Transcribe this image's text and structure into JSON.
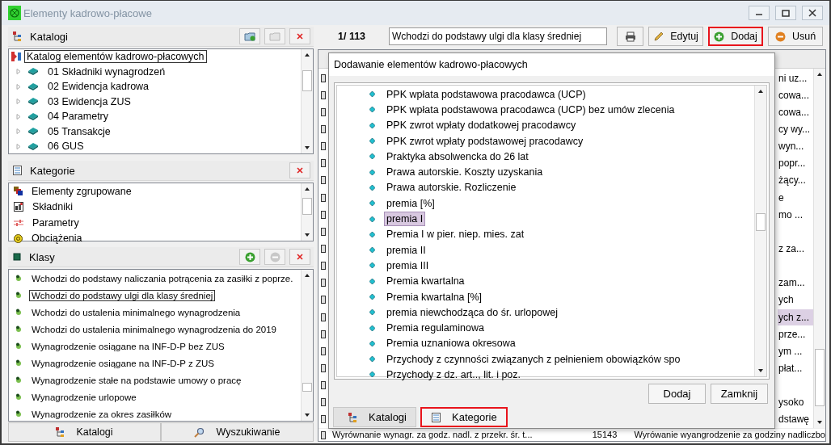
{
  "window": {
    "title": "Elementy kadrowo-płacowe"
  },
  "catalogs_panel": {
    "title": "Katalogi",
    "root": {
      "label": "Katalog elementów kadrowo-płacowych",
      "selected": true
    },
    "items": [
      {
        "label": "01 Składniki wynagrodzeń",
        "expanded": false
      },
      {
        "label": "02 Ewidencja kadrowa",
        "expanded": false
      },
      {
        "label": "03 Ewidencja ZUS",
        "expanded": false
      },
      {
        "label": "04 Parametry",
        "expanded": false
      },
      {
        "label": "05 Transakcje",
        "expanded": false
      },
      {
        "label": "06 GUS",
        "expanded": false
      }
    ]
  },
  "categories_panel": {
    "title": "Kategorie",
    "items": [
      {
        "label": "Elementy zgrupowane",
        "kind": "group"
      },
      {
        "label": "Składniki",
        "kind": "component"
      },
      {
        "label": "Parametry",
        "kind": "parameter"
      },
      {
        "label": "Obciążenia",
        "kind": "charge"
      }
    ]
  },
  "classes_panel": {
    "title": "Klasy",
    "items": [
      {
        "label": "Wchodzi do podstawy naliczania potrącenia za zasiłki z poprze.",
        "selected": false
      },
      {
        "label": "Wchodzi do podstawy ulgi dla klasy średniej",
        "selected": true
      },
      {
        "label": "Wchodzi do ustalenia minimalnego wynagrodzenia",
        "selected": false
      },
      {
        "label": "Wchodzi do ustalenia minimalnego wynagrodzenia do 2019",
        "selected": false
      },
      {
        "label": "Wynagrodzenie osiągane na INF-D-P bez ZUS",
        "selected": false
      },
      {
        "label": "Wynagrodzenie osiągane na INF-D-P z ZUS",
        "selected": false
      },
      {
        "label": "Wynagrodzenie stałe na podstawie umowy o pracę",
        "selected": false
      },
      {
        "label": "Wynagrodzenie urlopowe",
        "selected": false
      },
      {
        "label": "Wynagrodzenie za okres zasiłków",
        "selected": false
      }
    ]
  },
  "left_tabs": [
    {
      "label": "Katalogi",
      "kind": "catalogs"
    },
    {
      "label": "Wyszukiwanie",
      "kind": "search"
    }
  ],
  "toolbar": {
    "counter": "1/ 113",
    "field_value": "Wchodzi do podstawy ulgi dla klasy średniej",
    "buttons": [
      {
        "label": "Edytuj",
        "kind": "edit",
        "highlighted": false
      },
      {
        "label": "Dodaj",
        "kind": "add",
        "highlighted": true
      },
      {
        "label": "Usuń",
        "kind": "remove",
        "highlighted": false
      }
    ]
  },
  "grid": {
    "rows": [
      {
        "text": "ni uz...",
        "selected": false
      },
      {
        "text": "cowa...",
        "selected": false
      },
      {
        "text": "cowa...",
        "selected": false
      },
      {
        "text": "cy wy...",
        "selected": false
      },
      {
        "text": "wyn...",
        "selected": false
      },
      {
        "text": "popr...",
        "selected": false
      },
      {
        "text": "żący...",
        "selected": false
      },
      {
        "text": "e",
        "selected": false
      },
      {
        "text": "mo ...",
        "selected": false
      },
      {
        "selected": false
      },
      {
        "text": "z za...",
        "selected": false
      },
      {
        "selected": false
      },
      {
        "text": "zam...",
        "selected": false
      },
      {
        "text": "ych",
        "selected": false
      },
      {
        "text": "ych z...",
        "selected": true
      },
      {
        "text": "prze...",
        "selected": false
      },
      {
        "text": "ym ...",
        "selected": false
      },
      {
        "text": "płat...",
        "selected": false
      },
      {
        "selected": false
      },
      {
        "text": "ysoko",
        "selected": false
      },
      {
        "text": "dstawę",
        "selected": false
      }
    ],
    "bottom_row": [
      "Wyrównanie wynagr. za godz. nadl. z przekr. śr. t...",
      "15143",
      "Wyrówanie wyangrodzenie za godziny nadliczbo"
    ]
  },
  "dialog": {
    "title": "Dodawanie elementów kadrowo-płacowych",
    "items": [
      {
        "label": "PPK wpłata podstawowa pracodawca (UCP)",
        "selected": false
      },
      {
        "label": "PPK wpłata podstawowa pracodawca (UCP) bez umów zlecenia",
        "selected": false
      },
      {
        "label": "PPK zwrot wpłaty dodatkowej pracodawcy",
        "selected": false
      },
      {
        "label": "PPK zwrot wpłaty podstawowej pracodawcy",
        "selected": false
      },
      {
        "label": "Praktyka absolwencka do 26 lat",
        "selected": false
      },
      {
        "label": "Prawa autorskie. Koszty uzyskania",
        "selected": false
      },
      {
        "label": "Prawa autorskie. Rozliczenie",
        "selected": false
      },
      {
        "label": "premia [%]",
        "selected": false
      },
      {
        "label": "premia I",
        "selected": true
      },
      {
        "label": "Premia I w pier. niep. mies. zat",
        "selected": false
      },
      {
        "label": "premia II",
        "selected": false
      },
      {
        "label": "premia III",
        "selected": false
      },
      {
        "label": "Premia kwartalna",
        "selected": false
      },
      {
        "label": "Premia kwartalna [%]",
        "selected": false
      },
      {
        "label": "premia niewchodząca do śr. urlopowej",
        "selected": false
      },
      {
        "label": "Premia regulaminowa",
        "selected": false
      },
      {
        "label": "Premia uznaniowa okresowa",
        "selected": false
      },
      {
        "label": "Przychody z czynności związanych z pełnieniem obowiązków spo",
        "selected": false
      },
      {
        "label": "Przychody z dz. art.., lit. i poz.",
        "selected": false
      }
    ],
    "buttons": [
      "Dodaj",
      "Zamknij"
    ],
    "tabs": [
      {
        "label": "Katalogi",
        "kind": "catalogs",
        "selected": false
      },
      {
        "label": "Kategorie",
        "kind": "categories",
        "selected": true
      }
    ]
  }
}
